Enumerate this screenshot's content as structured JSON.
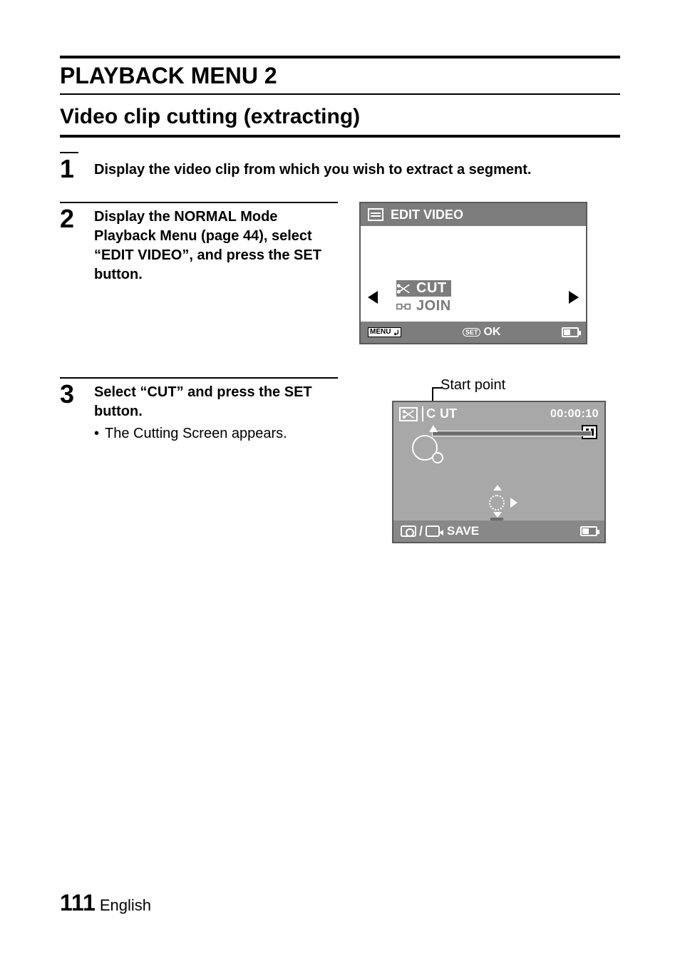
{
  "page": {
    "heading": "PLAYBACK MENU 2",
    "subheading": "Video clip cutting (extracting)",
    "number": "111",
    "language": "English"
  },
  "steps": {
    "s1": {
      "num": "1",
      "body": "Display the video clip from which you wish to extract a segment."
    },
    "s2": {
      "num": "2",
      "body": "Display the NORMAL Mode Playback Menu (page 44), select “EDIT VIDEO”, and press the SET button."
    },
    "s3": {
      "num": "3",
      "body": "Select “CUT” and press the SET button.",
      "sub": "The Cutting Screen appears."
    }
  },
  "screen1": {
    "title": "EDIT VIDEO",
    "items": {
      "cut": "CUT",
      "join": "JOIN"
    },
    "menu_label": "MENU",
    "ok_label": "OK",
    "set_label": "SET"
  },
  "screen2": {
    "callout": "Start point",
    "cut_prefix": "C",
    "cut_suffix": "UT",
    "time": "00:00:10",
    "save": "SAVE"
  }
}
